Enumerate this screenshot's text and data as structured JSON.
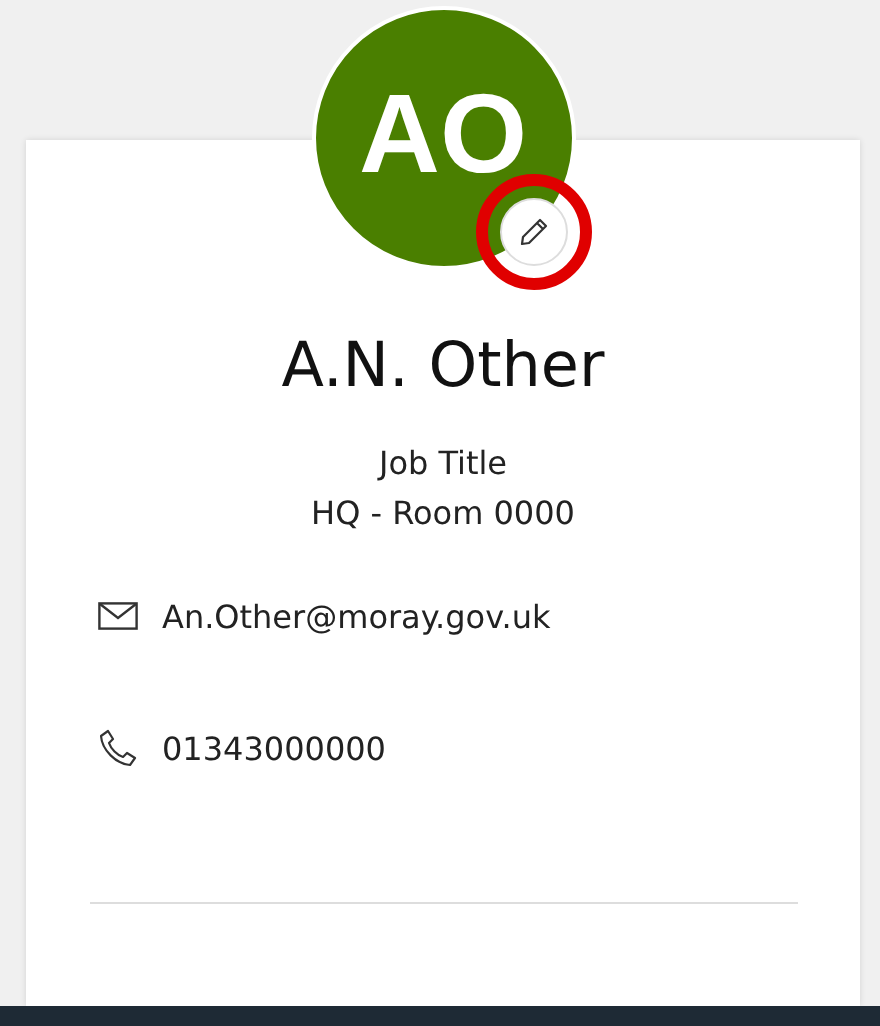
{
  "avatar": {
    "initials": "AO",
    "color": "#4a7f00"
  },
  "name": "A.N. Other",
  "job_title": "Job Title",
  "location": "HQ - Room 0000",
  "contacts": [
    {
      "kind": "email",
      "text": "An.Other@moray.gov.uk"
    },
    {
      "kind": "phone",
      "text": "01343000000"
    }
  ]
}
